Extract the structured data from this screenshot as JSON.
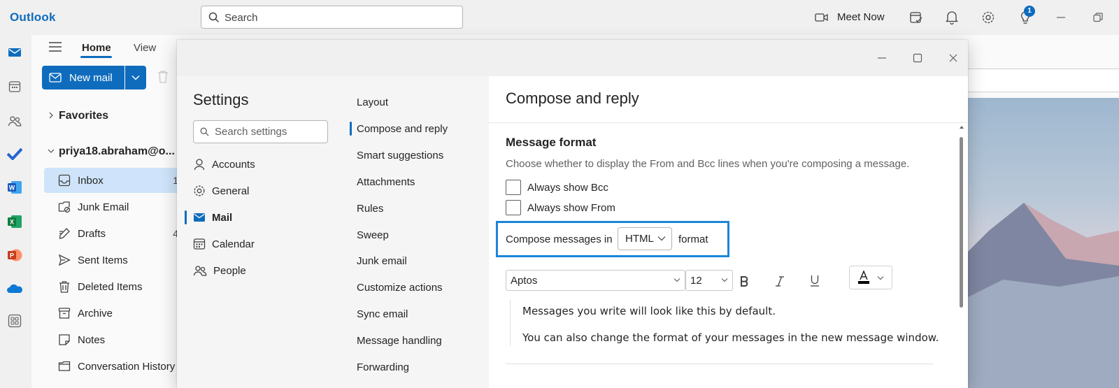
{
  "app": {
    "title": "Outlook"
  },
  "topbar": {
    "search_placeholder": "Search",
    "meet_now_label": "Meet Now",
    "notification_badge": "1",
    "icons": [
      "meet-now-icon",
      "my-day-icon",
      "notifications-icon",
      "settings-icon",
      "tips-icon",
      "minimize-icon",
      "restore-icon"
    ]
  },
  "rail": {
    "icons": [
      "mail-icon",
      "calendar-icon",
      "people-icon",
      "todo-icon",
      "word-icon",
      "excel-icon",
      "powerpoint-icon",
      "onedrive-icon",
      "more-apps-icon"
    ]
  },
  "ribbon": {
    "tabs": [
      {
        "label": "Home",
        "selected": true
      },
      {
        "label": "View",
        "selected": false
      }
    ],
    "new_mail_label": "New mail"
  },
  "folders": {
    "favorites_label": "Favorites",
    "account_label": "priya18.abraham@o...",
    "items": [
      {
        "label": "Inbox",
        "count": "1",
        "icon": "inbox-icon",
        "selected": true
      },
      {
        "label": "Junk Email",
        "count": "",
        "icon": "junk-icon",
        "selected": false
      },
      {
        "label": "Drafts",
        "count": "4",
        "icon": "drafts-icon",
        "selected": false
      },
      {
        "label": "Sent Items",
        "count": "",
        "icon": "sent-icon",
        "selected": false
      },
      {
        "label": "Deleted Items",
        "count": "",
        "icon": "deleted-icon",
        "selected": false
      },
      {
        "label": "Archive",
        "count": "",
        "icon": "archive-icon",
        "selected": false
      },
      {
        "label": "Notes",
        "count": "",
        "icon": "notes-icon",
        "selected": false
      },
      {
        "label": "Conversation History",
        "count": "",
        "icon": "folder-icon",
        "selected": false
      }
    ]
  },
  "settings": {
    "title": "Settings",
    "search_placeholder": "Search settings",
    "categories": [
      {
        "label": "Accounts",
        "icon": "person-icon",
        "selected": false
      },
      {
        "label": "General",
        "icon": "gear-icon",
        "selected": false
      },
      {
        "label": "Mail",
        "icon": "mail-icon",
        "selected": true
      },
      {
        "label": "Calendar",
        "icon": "calendar-icon",
        "selected": false
      },
      {
        "label": "People",
        "icon": "people-icon",
        "selected": false
      }
    ],
    "subcategories": [
      {
        "label": "Layout",
        "selected": false
      },
      {
        "label": "Compose and reply",
        "selected": true
      },
      {
        "label": "Smart suggestions",
        "selected": false
      },
      {
        "label": "Attachments",
        "selected": false
      },
      {
        "label": "Rules",
        "selected": false
      },
      {
        "label": "Sweep",
        "selected": false
      },
      {
        "label": "Junk email",
        "selected": false
      },
      {
        "label": "Customize actions",
        "selected": false
      },
      {
        "label": "Sync email",
        "selected": false
      },
      {
        "label": "Message handling",
        "selected": false
      },
      {
        "label": "Forwarding",
        "selected": false
      }
    ],
    "page": {
      "title": "Compose and reply",
      "section_title": "Message format",
      "section_description": "Choose whether to display the From and Bcc lines when you're composing a message.",
      "always_show_bcc": {
        "label": "Always show Bcc",
        "checked": false
      },
      "always_show_from": {
        "label": "Always show From",
        "checked": false
      },
      "compose_prefix": "Compose messages in",
      "compose_format": "HTML",
      "compose_suffix": "format",
      "font_name": "Aptos",
      "font_size": "12",
      "preview_line1": "Messages you write will look like this by default.",
      "preview_line2": "You can also change the format of your messages in the new message window."
    }
  },
  "colors": {
    "accent": "#0f6cbd",
    "highlight_box": "#1a86d9",
    "selected_folder_bg": "#cfe4fa"
  }
}
